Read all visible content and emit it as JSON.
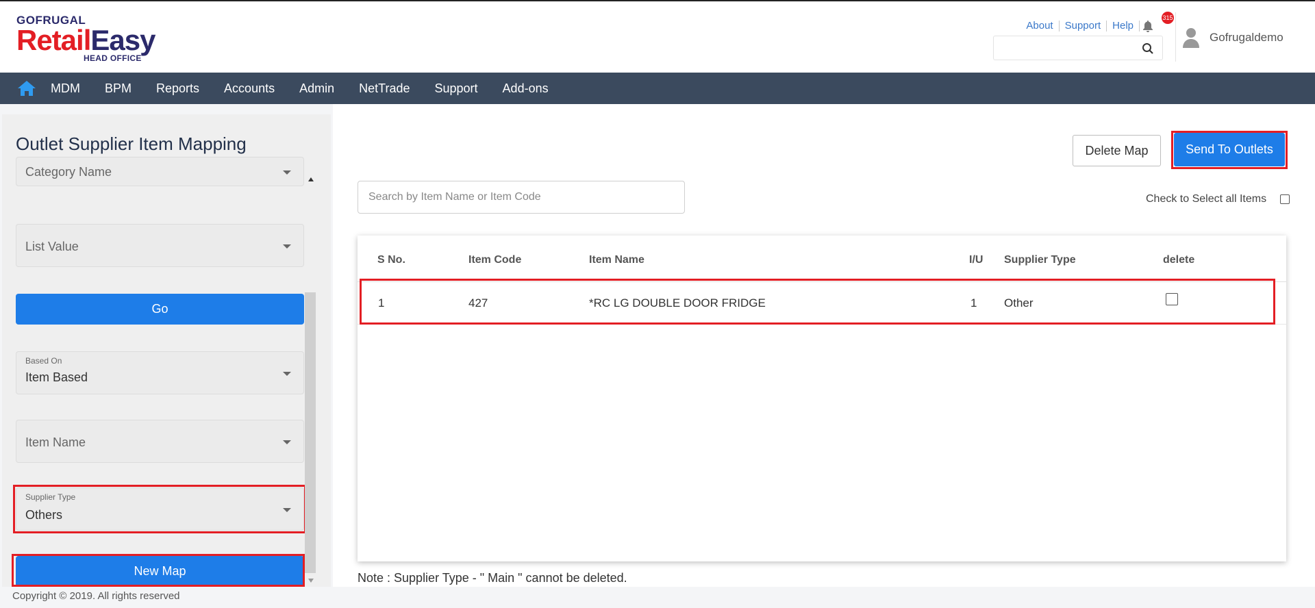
{
  "header": {
    "logo": {
      "top": "GOFRUGAL",
      "main_red": "Retail",
      "main_blue": "Easy",
      "sub": "HEAD OFFICE"
    },
    "links": [
      "About",
      "Support",
      "Help"
    ],
    "notification_count": "315",
    "search_placeholder": "",
    "user_name": "Gofrugaldemo"
  },
  "nav": {
    "home_icon": "home-icon",
    "items": [
      "MDM",
      "BPM",
      "Reports",
      "Accounts",
      "Admin",
      "NetTrade",
      "Support",
      "Add-ons"
    ]
  },
  "left_panel": {
    "title": "Outlet Supplier Item Mapping",
    "category_name": "Category Name",
    "list_value": "List Value",
    "go_label": "Go",
    "based_on": {
      "label": "Based On",
      "value": "Item Based"
    },
    "item_name": "Item Name",
    "supplier_type": {
      "label": "Supplier Type",
      "value": "Others"
    },
    "new_map_label": "New Map"
  },
  "main": {
    "delete_map_label": "Delete Map",
    "send_label": "Send To Outlets",
    "search_placeholder": "Search by Item Name or Item Code",
    "check_all_label": "Check to Select all Items",
    "table": {
      "columns": [
        "S No.",
        "Item Code",
        "Item Name",
        "I/U",
        "Supplier Type",
        "delete"
      ],
      "rows": [
        {
          "sno": "1",
          "code": "427",
          "name": "*RC LG DOUBLE DOOR FRIDGE",
          "iu": "1",
          "supplier_type": "Other",
          "delete_checked": false
        }
      ]
    },
    "note": "Note : Supplier Type - \" Main \" cannot be deleted."
  },
  "footer": {
    "copyright": "Copyright © 2019. All rights reserved"
  },
  "colors": {
    "accent": "#1e7de8",
    "nav_bg": "#3b4a5e",
    "highlight": "#e31e24",
    "brand_red": "#e31e24",
    "brand_blue": "#2b2a6b"
  }
}
